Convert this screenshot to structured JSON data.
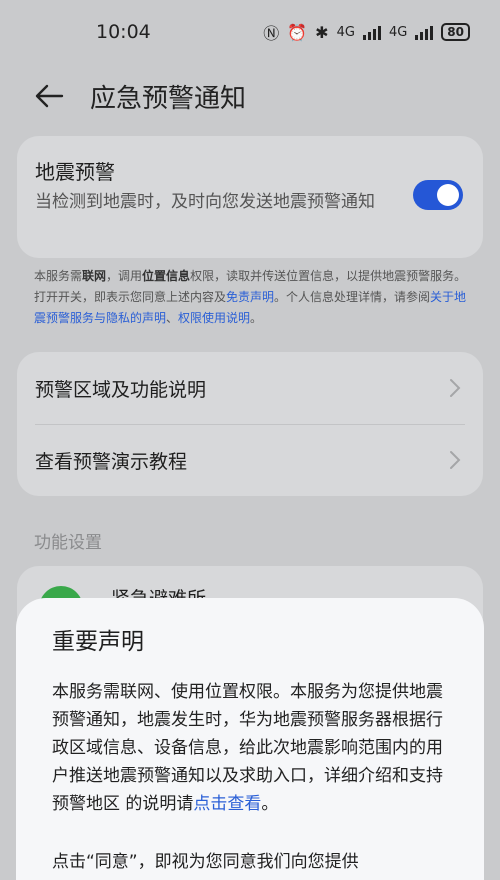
{
  "status_bar": {
    "time": "10:04",
    "signal1": "4G",
    "signal2": "4G",
    "battery": "80"
  },
  "header": {
    "title": "应急预警通知"
  },
  "quake_card": {
    "title": "地震预警",
    "description": "当检测到地震时，及时向您发送地震预警通知",
    "toggle_on": true
  },
  "notice": {
    "p1": "本服务需",
    "b1": "联网",
    "p2": "，调用",
    "b2": "位置信息",
    "p3": "权限，读取并传送位置信息，以提供地震预警服务。打开开关，即表示您同意上述内容及",
    "link1": "免责声明",
    "p4": "。个人信息处理详情，请参阅",
    "link2": "关于地震预警服务与隐私的声明",
    "p5": "、",
    "link3": "权限使用说明",
    "p6": "。"
  },
  "menu": {
    "items": [
      {
        "label": "预警区域及功能说明"
      },
      {
        "label": "查看预警演示教程"
      }
    ]
  },
  "section": {
    "label": "功能设置"
  },
  "settings": {
    "shelter_label": "紧急避难所"
  },
  "dialog": {
    "title": "重要声明",
    "body": "本服务需联网、使用位置权限。本服务为您提供地震预警通知，地震发生时，华为地震预警服务器根据行政区域信息、设备信息，给此次地震影响范围内的用户推送地震预警通知以及求助入口，详细介绍和支持预警地区 的说明请",
    "body_link": "点击查看",
    "body_end": "。",
    "body2": "点击“同意”，即视为您同意我们向您提供"
  }
}
